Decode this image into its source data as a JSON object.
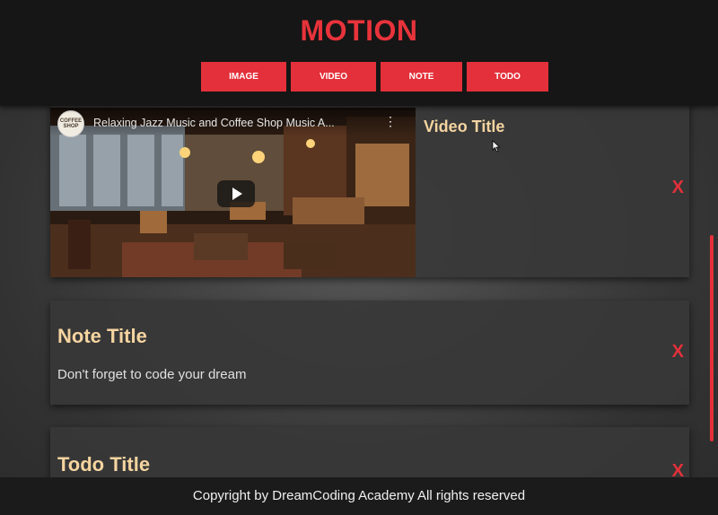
{
  "header": {
    "logo": "MOTION",
    "buttons": [
      "IMAGE",
      "VIDEO",
      "NOTE",
      "TODO"
    ]
  },
  "items": {
    "video": {
      "title": "Video Title",
      "caption": "Relaxing Jazz Music and Coffee Shop Music A...",
      "channel_logo_text": "COFFEE SHOP",
      "delete": "X"
    },
    "note": {
      "title": "Note Title",
      "body": "Don't forget to code your dream",
      "delete": "X"
    },
    "todo": {
      "title": "Todo Title",
      "delete": "X"
    }
  },
  "footer": {
    "copyright": "Copyright by DreamCoding Academy All rights reserved"
  },
  "colors": {
    "accent": "#e4303a",
    "title_text": "#f5d4a0",
    "header_bg": "#161616"
  }
}
